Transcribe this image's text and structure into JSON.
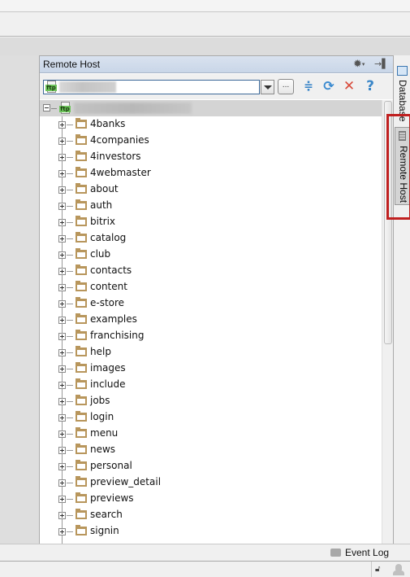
{
  "panel": {
    "title": "Remote Host",
    "header_icons": {
      "settings": "gear-icon",
      "hide": "hide-panel-icon"
    },
    "toolbar": {
      "server_combo": {
        "icon": "ftp-icon",
        "icon_text": "ftp",
        "value": ""
      },
      "browse_label": "...",
      "buttons": [
        {
          "name": "collapse-all",
          "icon": "collapse-all-icon",
          "glyph": "≑"
        },
        {
          "name": "refresh",
          "icon": "refresh-icon",
          "glyph": "⟳"
        },
        {
          "name": "disconnect",
          "icon": "close-icon",
          "glyph": "✕"
        },
        {
          "name": "help",
          "icon": "help-icon",
          "glyph": "?"
        }
      ]
    },
    "tree": {
      "root": {
        "icon": "ftp-icon",
        "icon_text": "ftp",
        "label": "",
        "expanded": true
      },
      "folders": [
        "4banks",
        "4companies",
        "4investors",
        "4webmaster",
        "about",
        "auth",
        "bitrix",
        "catalog",
        "club",
        "contacts",
        "content",
        "e-store",
        "examples",
        "franchising",
        "help",
        "images",
        "include",
        "jobs",
        "login",
        "menu",
        "news",
        "personal",
        "preview_detail",
        "previews",
        "search",
        "signin"
      ]
    },
    "scrollbar": {
      "visible_fraction": 0.55,
      "position": 0
    }
  },
  "side_tabs": [
    {
      "label": "Database",
      "icon": "database-icon",
      "active": false
    },
    {
      "label": "Remote Host",
      "icon": "remote-host-icon",
      "active": true
    }
  ],
  "status": {
    "event_log_label": "Event Log",
    "event_log_icon": "speech-bubble-icon",
    "lock_icon": "unlock-icon",
    "user_icon": "incognito-user-icon"
  }
}
